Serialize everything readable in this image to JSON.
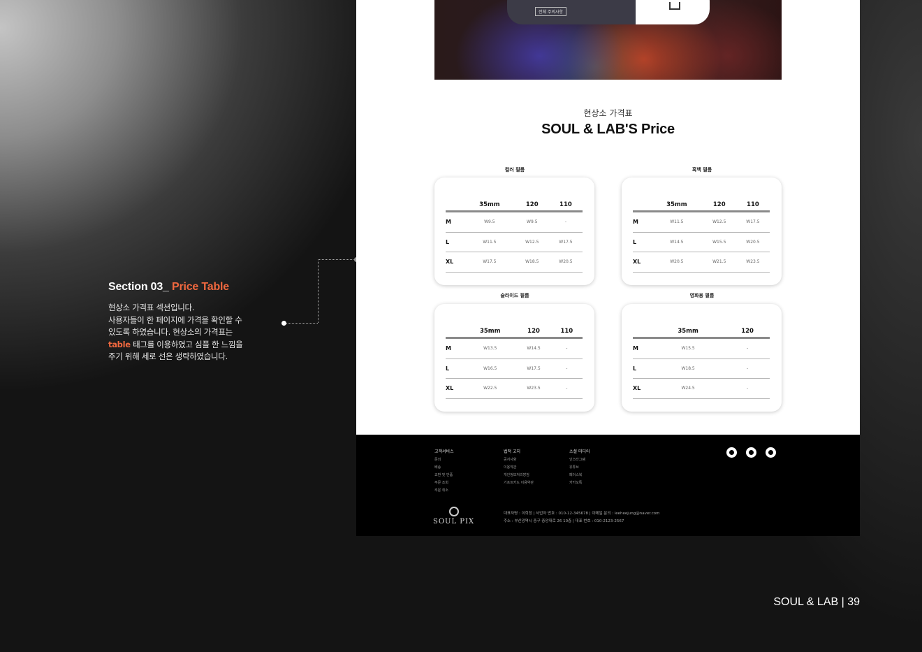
{
  "annotation": {
    "title_prefix": "Section 03_",
    "title_accent": "Price Table",
    "line1": "현상소 가격표 섹션입니다.",
    "line2": "사용자들이 한 페이지에 가격을 확인할 수",
    "line3": "있도록 하였습니다. 현상소의 가격표는",
    "line4_accent": "table",
    "line4_rest": " 태그를 이용하였고 심플 한 느낌을",
    "line5": "주기 위해 세로 선은 생략하였습니다."
  },
  "hero": {
    "button_label": "전체 주의사항"
  },
  "price_section": {
    "subtitle": "현상소 가격표",
    "title": "SOUL & LAB'S Price"
  },
  "tables": [
    {
      "label": "컬러 필름",
      "columns": [
        "35mm",
        "120",
        "110"
      ],
      "rows": [
        {
          "size": "M",
          "values": [
            "W9.5",
            "W9.5",
            "-"
          ]
        },
        {
          "size": "L",
          "values": [
            "W11.5",
            "W12.5",
            "W17.5"
          ]
        },
        {
          "size": "XL",
          "values": [
            "W17.5",
            "W18.5",
            "W20.5"
          ]
        }
      ]
    },
    {
      "label": "흑백 필름",
      "columns": [
        "35mm",
        "120",
        "110"
      ],
      "rows": [
        {
          "size": "M",
          "values": [
            "W11.5",
            "W12.5",
            "W17.5"
          ]
        },
        {
          "size": "L",
          "values": [
            "W14.5",
            "W15.5",
            "W20.5"
          ]
        },
        {
          "size": "XL",
          "values": [
            "W20.5",
            "W21.5",
            "W23.5"
          ]
        }
      ]
    },
    {
      "label": "슬라이드 필름",
      "columns": [
        "35mm",
        "120",
        "110"
      ],
      "rows": [
        {
          "size": "M",
          "values": [
            "W13.5",
            "W14.5",
            "-"
          ]
        },
        {
          "size": "L",
          "values": [
            "W16.5",
            "W17.5",
            "-"
          ]
        },
        {
          "size": "XL",
          "values": [
            "W22.5",
            "W23.5",
            "-"
          ]
        }
      ]
    },
    {
      "label": "영화용 필름",
      "columns": [
        "35mm",
        "120"
      ],
      "rows": [
        {
          "size": "M",
          "values": [
            "W15.5",
            "-"
          ]
        },
        {
          "size": "L",
          "values": [
            "W18.5",
            "-"
          ]
        },
        {
          "size": "XL",
          "values": [
            "W24.5",
            "-"
          ]
        }
      ]
    }
  ],
  "footer": {
    "col1": {
      "heading": "고객서비스",
      "items": [
        "문의",
        "배송",
        "교환 및 반품",
        "주문 조회",
        "주문 취소"
      ]
    },
    "col2": {
      "heading": "법적 고지",
      "items": [
        "공지사항",
        "이용약관",
        "개인정보처리방침",
        "기프트카드 이용약관"
      ]
    },
    "col3": {
      "heading": "소셜 미디어",
      "items": [
        "인스타그램",
        "유튜브",
        "페이스북",
        "카카오톡"
      ]
    },
    "social_icons": [
      "instagram-icon",
      "youtube-icon",
      "facebook-icon"
    ],
    "brand": "SOUL PIX",
    "info_line1": "대표자명 : 이희정  |  사업자 번호 : 010-12-345678  |  이메일 문의 : leeheejung@naver.com",
    "info_line2": "주소 : 부산광역시 중구 중앙대로 26 10층  |  대표 번호 : 010-2123-2567"
  },
  "page_number": "SOUL & LAB | 39"
}
